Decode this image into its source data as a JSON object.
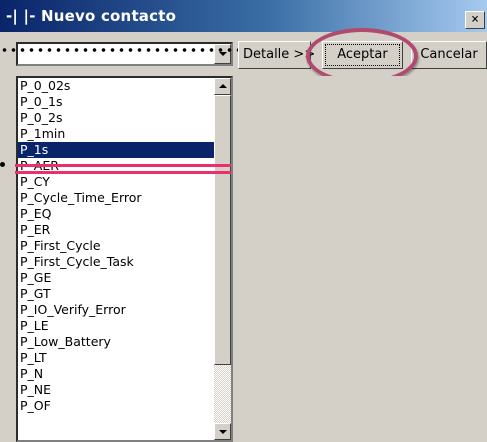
{
  "window": {
    "title": "-| |- Nuevo contacto",
    "close_glyph": "×"
  },
  "combo": {
    "value": ""
  },
  "buttons": {
    "detail_label": "Detalle >>",
    "accept_label": "Aceptar",
    "cancel_label": "Cancelar"
  },
  "list": {
    "selected_index": 4,
    "items": [
      "P_0_02s",
      "P_0_1s",
      "P_0_2s",
      "P_1min",
      "P_1s",
      "P_AER",
      "P_CY",
      "P_Cycle_Time_Error",
      "P_EQ",
      "P_ER",
      "P_First_Cycle",
      "P_First_Cycle_Task",
      "P_GE",
      "P_GT",
      "P_IO_Verify_Error",
      "P_LE",
      "P_Low_Battery",
      "P_LT",
      "P_N",
      "P_NE",
      "P_OF"
    ]
  },
  "annotation": {
    "highlight_color": "#b04a6e",
    "strike_color": "#e8306a"
  },
  "colors": {
    "selection": "#0a246a",
    "dialog_face": "#d4d0c8"
  },
  "icons": {
    "close": "close-icon",
    "combo_dropdown": "chevron-down-icon",
    "scroll_up": "scroll-up-arrow-icon",
    "scroll_down": "scroll-down-arrow-icon"
  }
}
